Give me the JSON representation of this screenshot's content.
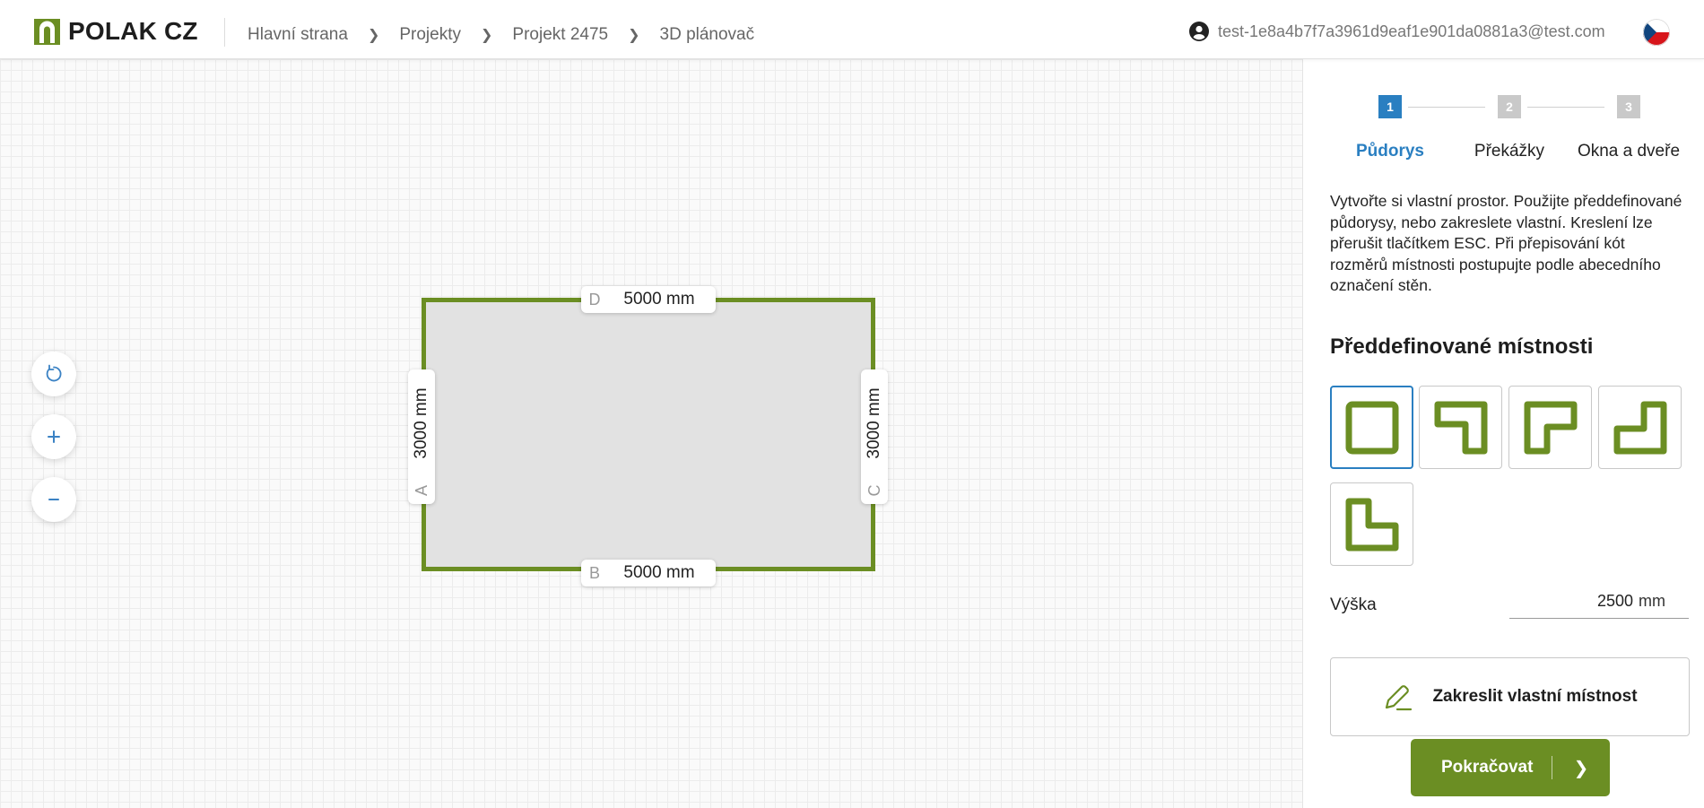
{
  "header": {
    "logo_text": "POLAK CZ",
    "breadcrumb": [
      "Hlavní strana",
      "Projekty",
      "Projekt 2475",
      "3D plánovač"
    ],
    "user_email": "test-1e8a4b7f7a3961d9eaf1e901da0881a3@test.com",
    "language_flag": "czech-flag-icon"
  },
  "canvas": {
    "tools": [
      "reset-rotate-icon",
      "zoom-in-icon",
      "zoom-out-icon"
    ],
    "room": {
      "wall_color": "#6b8e23",
      "walls": {
        "a": {
          "letter": "A",
          "value": "3000 mm"
        },
        "b": {
          "letter": "B",
          "value": "5000 mm"
        },
        "c": {
          "letter": "C",
          "value": "3000 mm"
        },
        "d": {
          "letter": "D",
          "value": "5000 mm"
        }
      }
    }
  },
  "sidebar": {
    "steps": [
      {
        "number": "1",
        "label": "Půdorys",
        "active": true
      },
      {
        "number": "2",
        "label": "Překážky",
        "active": false
      },
      {
        "number": "3",
        "label": "Okna a dveře",
        "active": false
      }
    ],
    "description": "Vytvořte si vlastní prostor. Použijte předdefinované půdorysy, nebo zakreslete vlastní. Kreslení lze přerušit tlačítkem ESC. Při přepisování kót rozměrů místnosti postupujte podle abecedního označení stěn.",
    "predefined_title": "Předdefinované místnosti",
    "shapes": [
      "rectangle-room-icon",
      "t-shape-room-icon",
      "l-shape-room-icon",
      "step-shape-room-icon",
      "l-bottom-room-icon"
    ],
    "height_label": "Výška",
    "height_value": "2500",
    "height_unit": "mm",
    "draw_button": "Zakreslit vlastní místnost",
    "continue_button": "Pokračovat",
    "accent_blue": "#2a7fc1",
    "accent_green": "#6b8e23"
  }
}
